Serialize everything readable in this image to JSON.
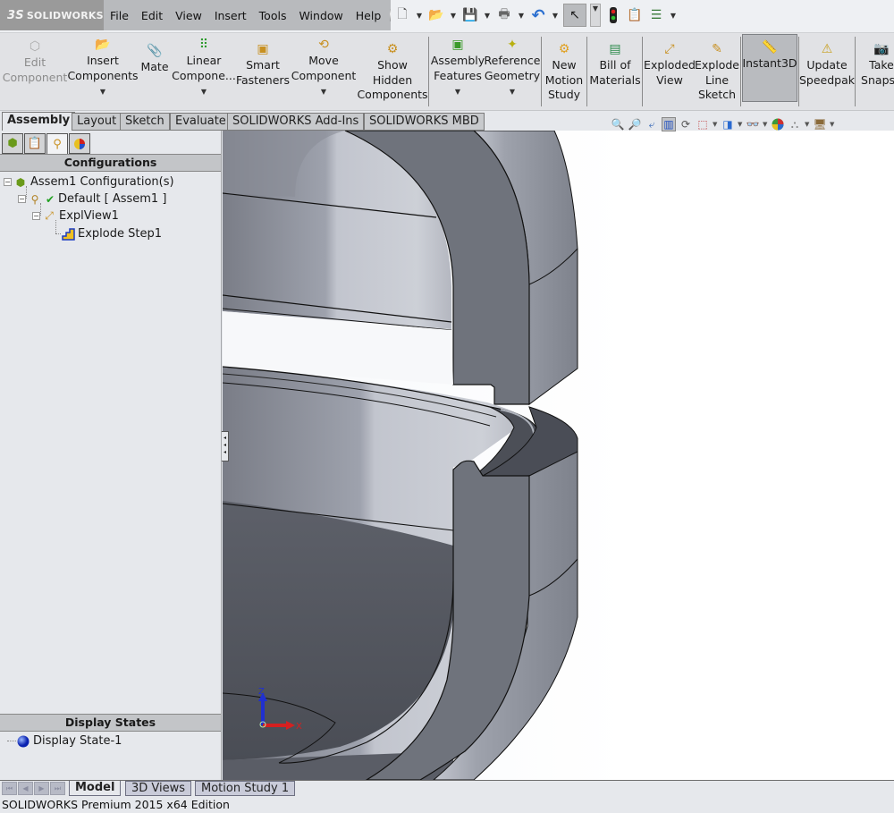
{
  "app": {
    "logo_text": "SOLIDWORKS",
    "logo_mark": "3S"
  },
  "menu": [
    "File",
    "Edit",
    "View",
    "Insert",
    "Tools",
    "Window",
    "Help"
  ],
  "quick_access": [
    {
      "name": "new-document-icon",
      "glyph": "🗋"
    },
    {
      "name": "open-folder-icon",
      "glyph": "📂"
    },
    {
      "name": "save-icon",
      "glyph": "💾"
    },
    {
      "name": "print-icon",
      "glyph": "🖶"
    },
    {
      "name": "undo-icon",
      "glyph": "↶"
    },
    {
      "name": "select-arrow-icon",
      "glyph": "↖"
    },
    {
      "name": "rebuild-traffic-light-icon",
      "glyph": "⬮"
    },
    {
      "name": "file-properties-icon",
      "glyph": "📋"
    },
    {
      "name": "options-list-icon",
      "glyph": "☰"
    }
  ],
  "commands": [
    {
      "id": "edit-component",
      "label": [
        "Edit",
        "Component"
      ],
      "glyph": "⬡",
      "disabled": true,
      "dropdown": false
    },
    {
      "id": "insert-components",
      "label": [
        "Insert",
        "Components"
      ],
      "glyph": "📂",
      "dropdown": true
    },
    {
      "id": "mate",
      "label": [
        "Mate"
      ],
      "glyph": "📎",
      "dropdown": false
    },
    {
      "id": "linear-component-pattern",
      "label": [
        "Linear",
        "Compone..."
      ],
      "glyph": "⠿",
      "dropdown": true
    },
    {
      "id": "smart-fasteners",
      "label": [
        "Smart",
        "Fasteners"
      ],
      "glyph": "🔩",
      "dropdown": false
    },
    {
      "id": "move-component",
      "label": [
        "Move",
        "Component"
      ],
      "glyph": "⟲",
      "dropdown": true
    },
    {
      "id": "show-hidden-components",
      "label": [
        "Show",
        "Hidden",
        "Components"
      ],
      "glyph": "⚙",
      "dropdown": false
    },
    {
      "id": "assembly-features",
      "label": [
        "Assembly",
        "Features"
      ],
      "glyph": "▣",
      "dropdown": true
    },
    {
      "id": "reference-geometry",
      "label": [
        "Reference",
        "Geometry"
      ],
      "glyph": "✦",
      "dropdown": true
    },
    {
      "id": "new-motion-study",
      "label": [
        "New",
        "Motion",
        "Study"
      ],
      "glyph": "⚙",
      "dropdown": false
    },
    {
      "id": "bill-of-materials",
      "label": [
        "Bill of",
        "Materials"
      ],
      "glyph": "▤",
      "dropdown": false
    },
    {
      "id": "exploded-view",
      "label": [
        "Exploded",
        "View"
      ],
      "glyph": "⤢",
      "dropdown": false
    },
    {
      "id": "explode-line-sketch",
      "label": [
        "Explode",
        "Line",
        "Sketch"
      ],
      "glyph": "✎",
      "dropdown": false
    },
    {
      "id": "instant3d",
      "label": [
        "Instant3D"
      ],
      "glyph": "📏",
      "dropdown": false,
      "active": true
    },
    {
      "id": "update-speedpak",
      "label": [
        "Update",
        "Speedpak"
      ],
      "glyph": "⚠",
      "dropdown": false
    },
    {
      "id": "take-snapshot",
      "label": [
        "Take",
        "Snapsh"
      ],
      "glyph": "📷",
      "dropdown": false
    }
  ],
  "tabs": [
    "Assembly",
    "Layout",
    "Sketch",
    "Evaluate",
    "SOLIDWORKS Add-Ins",
    "SOLIDWORKS MBD"
  ],
  "active_tab": "Assembly",
  "panel": {
    "tab_icons": [
      "featuremanager-tree-icon",
      "propertymanager-icon",
      "configurationmanager-icon",
      "displaymanager-icon"
    ],
    "configurations_header": "Configurations",
    "tree": [
      {
        "label": "Assem1 Configuration(s)",
        "icon": "assembly-icon",
        "level": 0
      },
      {
        "label": "Default [ Assem1 ]",
        "icon": "configuration-icon",
        "level": 1,
        "checked": true
      },
      {
        "label": "ExplView1",
        "icon": "exploded-view-icon",
        "level": 2
      },
      {
        "label": "Explode Step1",
        "icon": "explode-step-icon",
        "level": 3
      }
    ],
    "display_states_header": "Display States",
    "display_states": [
      {
        "label": "Display State-1"
      }
    ]
  },
  "heads_up_toolbar": [
    "zoom-to-fit-icon",
    "zoom-to-area-icon",
    "previous-view-icon",
    "section-view-icon",
    "dynamic-annotation-icon",
    "view-orientation-icon",
    "display-style-icon",
    "hide-show-items-icon",
    "edit-appearance-icon",
    "apply-scene-icon",
    "view-settings-icon"
  ],
  "triad": {
    "x_label": "X",
    "z_label": "Z"
  },
  "bottom_tabs": [
    "Model",
    "3D Views",
    "Motion Study 1"
  ],
  "active_bottom_tab": "Model",
  "status": "SOLIDWORKS Premium 2015 x64 Edition",
  "colors": {
    "model_dark": "#6f737c",
    "model_mid": "#a4a8b2",
    "model_light": "#cfd2d9",
    "triad_x": "#d42020",
    "triad_z": "#2030d0"
  }
}
